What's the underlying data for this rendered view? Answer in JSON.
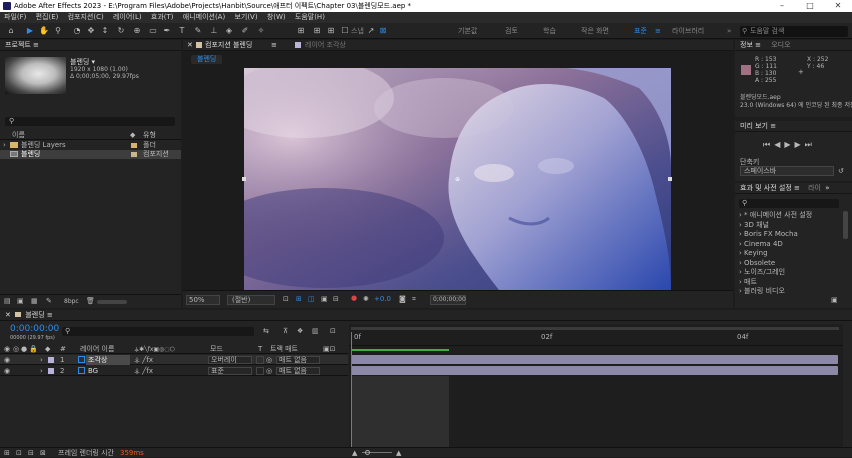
{
  "window": {
    "title": "Adobe After Effects 2023 - E:\\Program Files\\Adobe\\Projects\\Hanbit\\Source\\애프터 이펙트\\Chapter 03\\블렌딩모드.aep *",
    "min": "–",
    "max": "□",
    "close": "✕"
  },
  "menu": [
    "파일(F)",
    "편집(E)",
    "컴포지션(C)",
    "레이어(L)",
    "효과(T)",
    "애니메이션(A)",
    "보기(V)",
    "창(W)",
    "도움말(H)"
  ],
  "toolbar": {
    "snap_label": "스냅",
    "workspaces": [
      "기본값",
      "검토",
      "학습",
      "작은 화면",
      "표준",
      "라이브러리"
    ],
    "active_ws": "표준",
    "search_placeholder": "도움말 검색"
  },
  "project": {
    "tab": "프로젝트",
    "item_name": "블렌딩 ▾",
    "item_size": "1920 x 1080 (1.00)",
    "item_dur": "Δ 0;00;05;00, 29.97fps",
    "col_name": "이름",
    "col_type": "유형",
    "items": [
      {
        "name": "블렌딩 Layers",
        "type": "폴더",
        "color": "#d6b36c"
      },
      {
        "name": "블렌딩",
        "type": "컴포지션",
        "color": "#c9b58e"
      }
    ],
    "bpc": "8bpc"
  },
  "comp": {
    "tab": "컴포지션 블렌딩",
    "tab2": "레이어 조각상",
    "flow": "블렌딩",
    "zoom": "50%",
    "res": "(절반)",
    "time": "0;00;00;00",
    "exposure": "+0.0"
  },
  "info": {
    "tab": "정보",
    "tab2": "오디오",
    "r": "R : 153",
    "g": "G : 111",
    "b": "B : 130",
    "a": "A : 255",
    "x": "X : 252",
    "y": "Y : 46",
    "swatch": "#a27083",
    "file": "블렌딩모드.aep",
    "ver": "23.0 (Windows 64) 에 인코딩 된 최종 저장"
  },
  "preview": {
    "tab": "미리 보기",
    "shortcut": "단축키",
    "shortcut_val": "스페이스바"
  },
  "effects": {
    "tab": "효과 및 사전 설정",
    "tab2": "라이",
    "list": [
      "* 애니메이션 사전 설정",
      "3D 채널",
      "Boris FX Mocha",
      "Cinema 4D",
      "Keying",
      "Obsolete",
      "노이즈/그레인",
      "매트",
      "블러링 비디오"
    ]
  },
  "timeline": {
    "tab": "블렌딩",
    "time": "0:00:00:00",
    "fps": "00000 (29.97 fps)",
    "cols": {
      "num": "#",
      "name": "레이어 이름",
      "mode": "모드",
      "t": "T",
      "trkmat": "트랙 매트"
    },
    "ruler": [
      "0f",
      "02f",
      "04f"
    ],
    "layers": [
      {
        "n": "1",
        "name": "조각상",
        "mode": "오버레이",
        "matte": "매트 없음",
        "color": "#b7b3d8"
      },
      {
        "n": "2",
        "name": "BG",
        "mode": "표준",
        "matte": "매트 없음",
        "color": "#b7b3d8"
      }
    ],
    "footer": "프레임 렌더링 시간",
    "render_ms": "359ms"
  }
}
